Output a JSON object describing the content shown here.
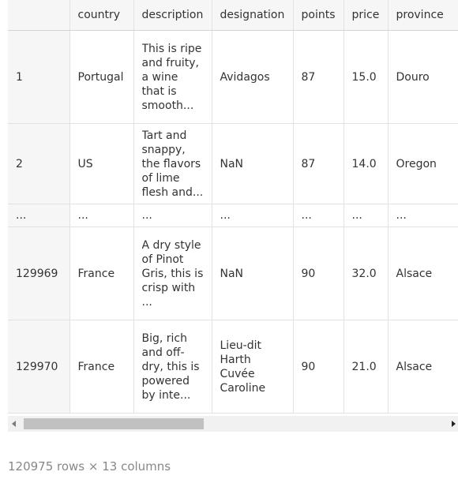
{
  "columns": [
    "",
    "country",
    "description",
    "designation",
    "points",
    "price",
    "province"
  ],
  "rows": [
    [
      "1",
      "Portugal",
      "This is ripe and fruity, a wine that is smooth...",
      "Avidagos",
      "87",
      "15.0",
      "Douro"
    ],
    [
      "2",
      "US",
      "Tart and snappy, the flavors of lime flesh and...",
      "NaN",
      "87",
      "14.0",
      "Oregon"
    ],
    [
      "...",
      "...",
      "...",
      "...",
      "...",
      "...",
      "..."
    ],
    [
      "129969",
      "France",
      "A dry style of Pinot Gris, this is crisp with ...",
      "NaN",
      "90",
      "32.0",
      "Alsace"
    ],
    [
      "129970",
      "France",
      "Big, rich and off-dry, this is powered by inte...",
      "Lieu-dit Harth Cuvée Caroline",
      "90",
      "21.0",
      "Alsace"
    ]
  ],
  "footer": "120975 rows × 13 columns"
}
